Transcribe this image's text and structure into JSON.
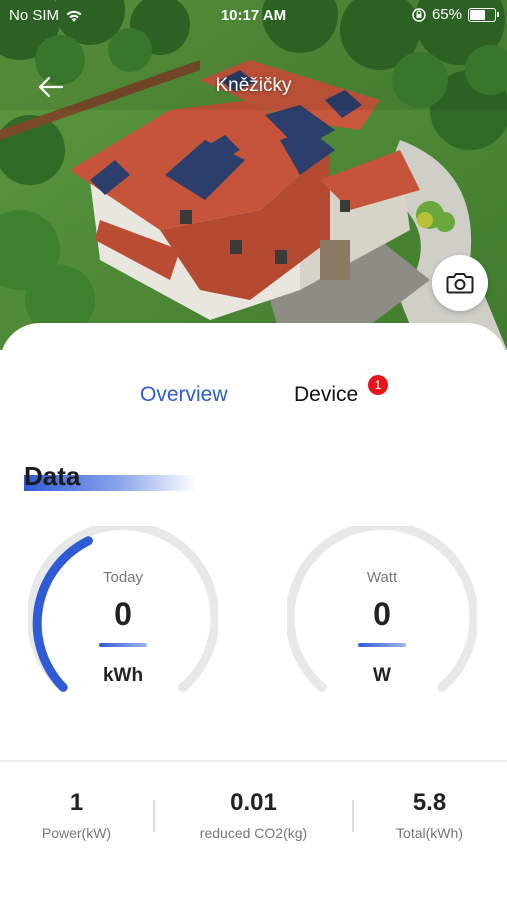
{
  "status_bar": {
    "carrier": "No SIM",
    "time": "10:17 AM",
    "battery_text": "65%",
    "battery_level": 0.65
  },
  "header": {
    "title": "Kněžičky"
  },
  "tabs": {
    "overview": "Overview",
    "device": "Device",
    "device_badge": "1"
  },
  "data_section": {
    "title": "Data",
    "gauges": [
      {
        "label": "Today",
        "value": "0",
        "unit": "kWh"
      },
      {
        "label": "Watt",
        "value": "0",
        "unit": "W"
      }
    ]
  },
  "stats": [
    {
      "value": "1",
      "label": "Power(kW)"
    },
    {
      "value": "0.01",
      "label": "reduced CO2(kg)"
    },
    {
      "value": "5.8",
      "label": "Total(kWh)"
    }
  ],
  "colors": {
    "accent": "#2f5bd6",
    "badge": "#e8141c",
    "gauge_track": "#e8e8e8"
  }
}
